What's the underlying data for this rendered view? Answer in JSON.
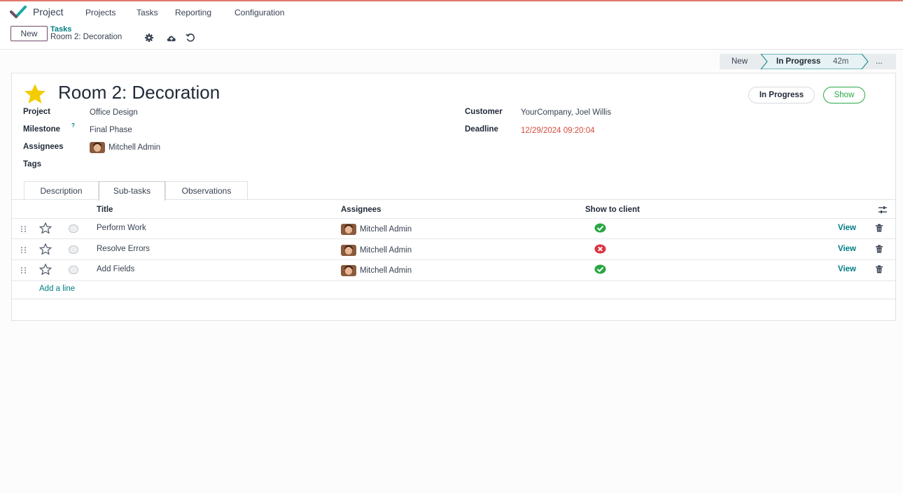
{
  "app": {
    "name": "Project",
    "accent": "#714b67",
    "link_color": "#017e84",
    "menu": [
      "Projects",
      "Tasks",
      "Reporting",
      "Configuration"
    ]
  },
  "control": {
    "new_label": "New",
    "breadcrumb_parent": "Tasks",
    "breadcrumb_current": "Room 2: Decoration"
  },
  "stages": {
    "items": [
      "New",
      "In Progress",
      "..."
    ],
    "active_time": "42m"
  },
  "task": {
    "title": "Room 2: Decoration",
    "status_pill": "In Progress",
    "show_button": "Show",
    "fields": {
      "project_label": "Project",
      "project_value": "Office Design",
      "milestone_label": "Milestone",
      "milestone_hint": "?",
      "milestone_value": "Final Phase",
      "assignees_label": "Assignees",
      "assignee_value": "Mitchell Admin",
      "tags_label": "Tags",
      "customer_label": "Customer",
      "customer_value": "YourCompany, Joel Willis",
      "deadline_label": "Deadline",
      "deadline_value": "12/29/2024 09:20:04",
      "deadline_color": "#d44c3b"
    }
  },
  "tabs": [
    "Description",
    "Sub-tasks",
    "Observations"
  ],
  "subtasks": {
    "headers": {
      "title": "Title",
      "assignees": "Assignees",
      "show_to_client": "Show to client"
    },
    "rows": [
      {
        "title": "Perform Work",
        "assignee": "Mitchell Admin",
        "show_to_client": "check-icon",
        "action": "View"
      },
      {
        "title": "Resolve Errors",
        "assignee": "Mitchell Admin",
        "show_to_client": "cross-icon",
        "action": "View"
      },
      {
        "title": "Add Fields",
        "assignee": "Mitchell Admin",
        "show_to_client": "check-icon",
        "action": "View"
      }
    ],
    "add_line": "Add a line",
    "success_color": "#28a745",
    "danger_color": "#dc3545"
  }
}
